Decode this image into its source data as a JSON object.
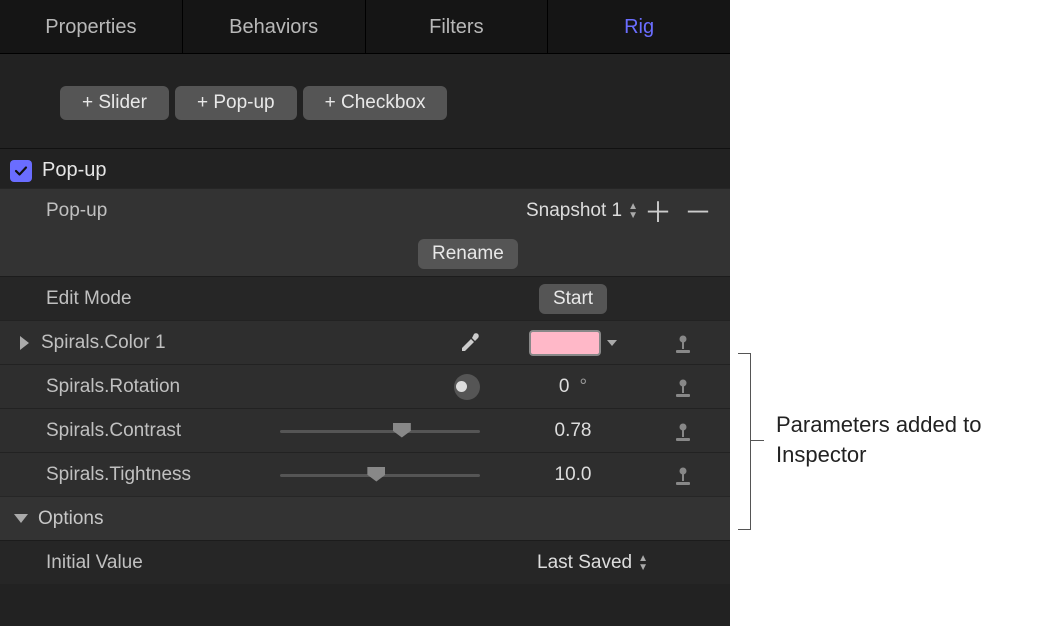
{
  "tabs": {
    "properties": "Properties",
    "behaviors": "Behaviors",
    "filters": "Filters",
    "rig": "Rig"
  },
  "add_buttons": {
    "slider": "+ Slider",
    "popup": "+ Pop-up",
    "checkbox": "+ Checkbox"
  },
  "section": {
    "title": "Pop-up",
    "popup_row": {
      "label": "Pop-up",
      "value": "Snapshot 1"
    },
    "rename_btn": "Rename",
    "edit_mode": {
      "label": "Edit Mode",
      "button": "Start"
    },
    "params": {
      "color": {
        "label": "Spirals.Color 1",
        "swatch": "#ffb8c8"
      },
      "rotation": {
        "label": "Spirals.Rotation",
        "value": "0",
        "unit": "°"
      },
      "contrast": {
        "label": "Spirals.Contrast",
        "value": "0.78",
        "slider_pct": 62
      },
      "tightness": {
        "label": "Spirals.Tightness",
        "value": "10.0",
        "slider_pct": 48
      }
    },
    "options": {
      "header": "Options",
      "initial_value": {
        "label": "Initial Value",
        "value": "Last Saved"
      }
    }
  },
  "annotation": "Parameters added to Inspector"
}
